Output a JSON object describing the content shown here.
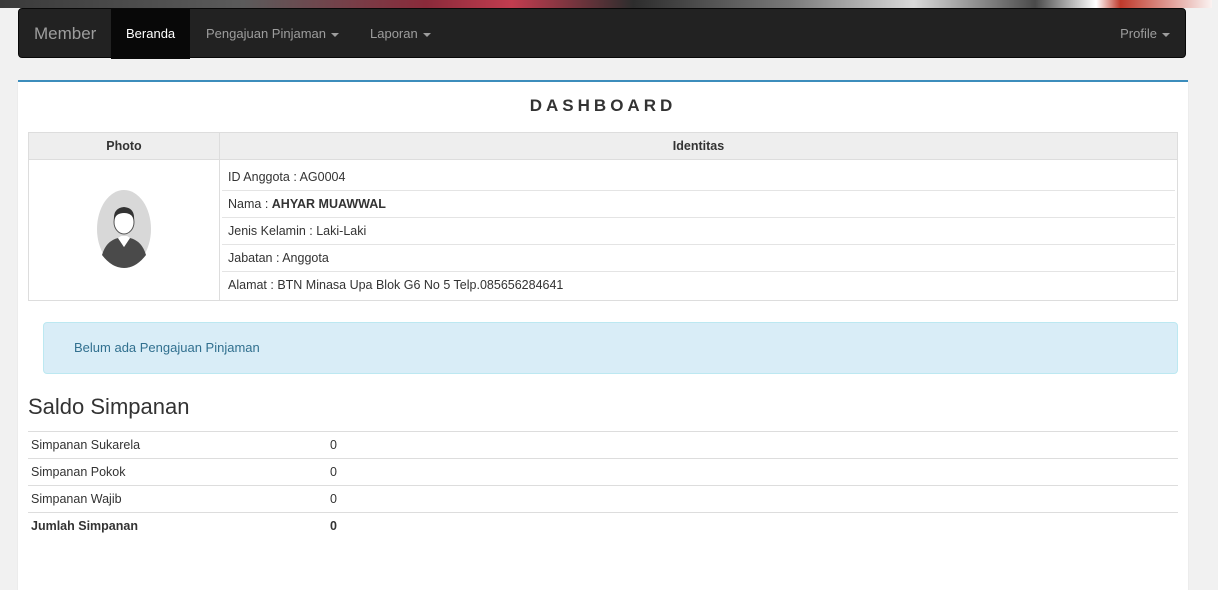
{
  "navbar": {
    "brand": "Member",
    "items": [
      {
        "label": "Beranda",
        "active": true
      },
      {
        "label": "Pengajuan Pinjaman",
        "dropdown": true
      },
      {
        "label": "Laporan",
        "dropdown": true
      }
    ],
    "profile": "Profile"
  },
  "dashboard": {
    "title": "DASHBOARD",
    "headers": {
      "photo": "Photo",
      "identity": "Identitas"
    },
    "identity": {
      "id_label": "ID Anggota : ",
      "id_value": "AG0004",
      "name_label": "Nama : ",
      "name_value": "AHYAR MUAWWAL",
      "gender_label": "Jenis Kelamin : ",
      "gender_value": "Laki-Laki",
      "position_label": "Jabatan : ",
      "position_value": "Anggota",
      "address_label": "Alamat : ",
      "address_value": "BTN Minasa Upa Blok G6 No 5 Telp.085656284641"
    }
  },
  "alert": {
    "text": "Belum ada Pengajuan Pinjaman"
  },
  "saldo": {
    "title": "Saldo Simpanan",
    "rows": [
      {
        "label": "Simpanan Sukarela",
        "value": "0"
      },
      {
        "label": "Simpanan Pokok",
        "value": "0"
      },
      {
        "label": "Simpanan Wajib",
        "value": "0"
      }
    ],
    "total": {
      "label": "Jumlah Simpanan",
      "value": "0"
    }
  },
  "colors": {
    "navbar": "#222222",
    "accent": "#3c8dbc",
    "alert_bg": "#d9edf7",
    "alert_text": "#31708f"
  }
}
